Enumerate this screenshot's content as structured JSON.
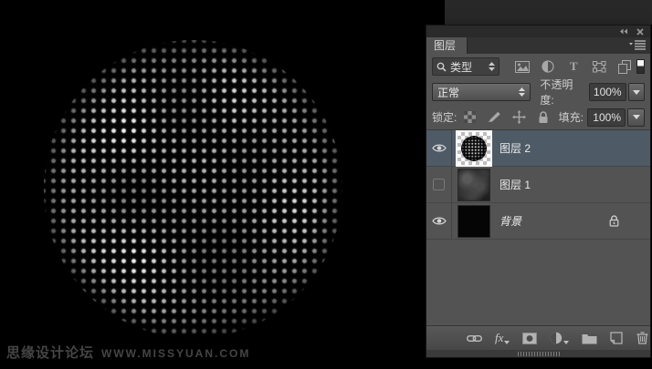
{
  "colors": {
    "canvas_bg": "#000000",
    "panel_bg": "#535353",
    "selected_row": "#4e5a66"
  },
  "watermark": {
    "site_name": "思缘设计论坛",
    "site_url": "WWW.MISSYUAN.COM"
  },
  "panel": {
    "tab_title": "图层",
    "window_controls": {
      "icons": [
        "collapse-to-icons",
        "close"
      ]
    },
    "filter": {
      "search_label": "类型",
      "text_icon_glyph": "T",
      "kind_icons": [
        "pixel-layer-filter",
        "adjustment-layer-filter",
        "type-layer-filter",
        "shape-layer-filter",
        "smart-object-filter",
        "filter-toggle"
      ]
    },
    "blend": {
      "mode": "正常",
      "opacity_label": "不透明度:",
      "opacity_value": "100%"
    },
    "lock": {
      "label": "锁定:",
      "icons": [
        "lock-transparency",
        "lock-pixels",
        "lock-position",
        "lock-all"
      ],
      "fill_label": "填充:",
      "fill_value": "100%"
    },
    "layers": [
      {
        "name": "图层 2",
        "visible": true,
        "selected": true,
        "thumbnail": "sphere-on-transparency"
      },
      {
        "name": "图层 1",
        "visible": false,
        "selected": false,
        "thumbnail": "gray-clouds"
      },
      {
        "name": "背景",
        "visible": true,
        "selected": false,
        "locked": true,
        "thumbnail": "solid-black"
      }
    ],
    "bottom_bar": {
      "fx_label": "fx",
      "icons": [
        "link-layers",
        "layer-style",
        "add-layer-mask",
        "new-adjustment-layer",
        "new-group",
        "new-layer",
        "delete-layer"
      ]
    }
  }
}
